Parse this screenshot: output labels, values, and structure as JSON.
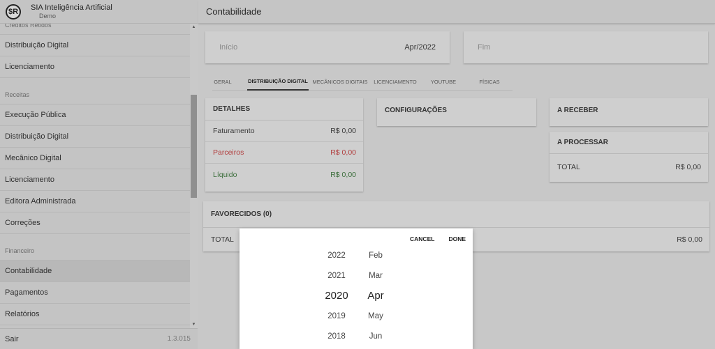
{
  "brand": {
    "name": "SIA Inteligência Artificial",
    "subtitle": "Demo",
    "logo_text": "$R"
  },
  "sidebar": {
    "top_hidden_label": "Créditos Retidos",
    "items_group1": [
      "Distribuição Digital",
      "Licenciamento"
    ],
    "section_receitas": "Receitas",
    "items_receitas": [
      "Execução Pública",
      "Distribuição Digital",
      "Mecânico Digital",
      "Licenciamento",
      "Editora Administrada",
      "Correções"
    ],
    "section_financeiro": "Financeiro",
    "items_financeiro": [
      "Contabilidade",
      "Pagamentos",
      "Relatórios"
    ],
    "active_item": "Contabilidade",
    "footer_logout": "Sair",
    "footer_version": "1.3.015"
  },
  "header": {
    "title": "Contabilidade"
  },
  "date_range": {
    "start_label": "Início",
    "start_value": "Apr/2022",
    "end_label": "Fim",
    "end_value": ""
  },
  "tabs": [
    "GERAL",
    "DISTRIBUIÇÃO DIGITAL",
    "MECÂNICOS DIGITAIS",
    "LICENCIAMENTO",
    "YOUTUBE",
    "FÍSICAS"
  ],
  "active_tab": "DISTRIBUIÇÃO DIGITAL",
  "detalhes": {
    "title": "DETALHES",
    "rows": [
      {
        "label": "Faturamento",
        "value": "R$ 0,00"
      },
      {
        "label": "Parceiros",
        "value": "R$ 0,00"
      },
      {
        "label": "Líquido",
        "value": "R$ 0,00"
      }
    ]
  },
  "configuracoes": {
    "title": "CONFIGURAÇÕES"
  },
  "a_receber": {
    "title": "A RECEBER"
  },
  "a_processar": {
    "title": "A PROCESSAR",
    "total_label": "TOTAL",
    "total_value": "R$ 0,00"
  },
  "favorecidos": {
    "title": "FAVORECIDOS (0)",
    "total_label": "TOTAL",
    "total_value": "R$ 0,00"
  },
  "picker": {
    "cancel_label": "CANCEL",
    "done_label": "DONE",
    "years": [
      "2022",
      "2021",
      "2020",
      "2019",
      "2018"
    ],
    "months": [
      "Feb",
      "Mar",
      "Apr",
      "May",
      "Jun"
    ],
    "selected_year": "2020",
    "selected_month": "Apr"
  },
  "colors": {
    "negative": "#b13c3c",
    "positive": "#3b6e3b"
  }
}
